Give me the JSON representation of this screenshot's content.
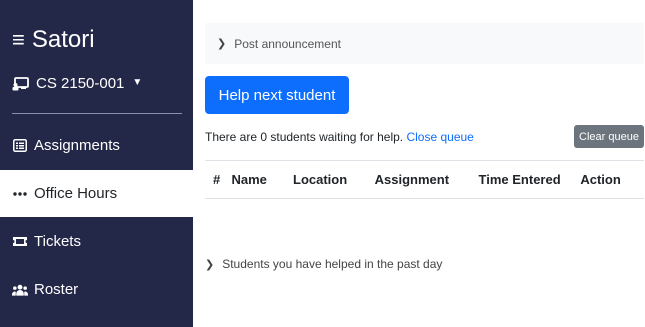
{
  "sidebar": {
    "brand": "Satori",
    "course": "CS 2150-001",
    "items": [
      {
        "label": "Assignments",
        "icon": "list-icon"
      },
      {
        "label": "Office Hours",
        "icon": "dots-icon"
      },
      {
        "label": "Tickets",
        "icon": "ticket-icon"
      },
      {
        "label": "Roster",
        "icon": "users-icon"
      }
    ]
  },
  "main": {
    "announcement": "Post announcement",
    "help_button": "Help next student",
    "waiting_text": "There are 0 students waiting for help.",
    "close_queue": "Close queue",
    "clear_queue": "Clear queue",
    "table": {
      "columns": [
        "#",
        "Name",
        "Location",
        "Assignment",
        "Time Entered",
        "Action"
      ],
      "rows": []
    },
    "helped_label": "Students you have helped in the past day"
  },
  "colors": {
    "sidebar_bg": "#232849",
    "primary": "#0d6efd",
    "secondary": "#6c757d"
  }
}
